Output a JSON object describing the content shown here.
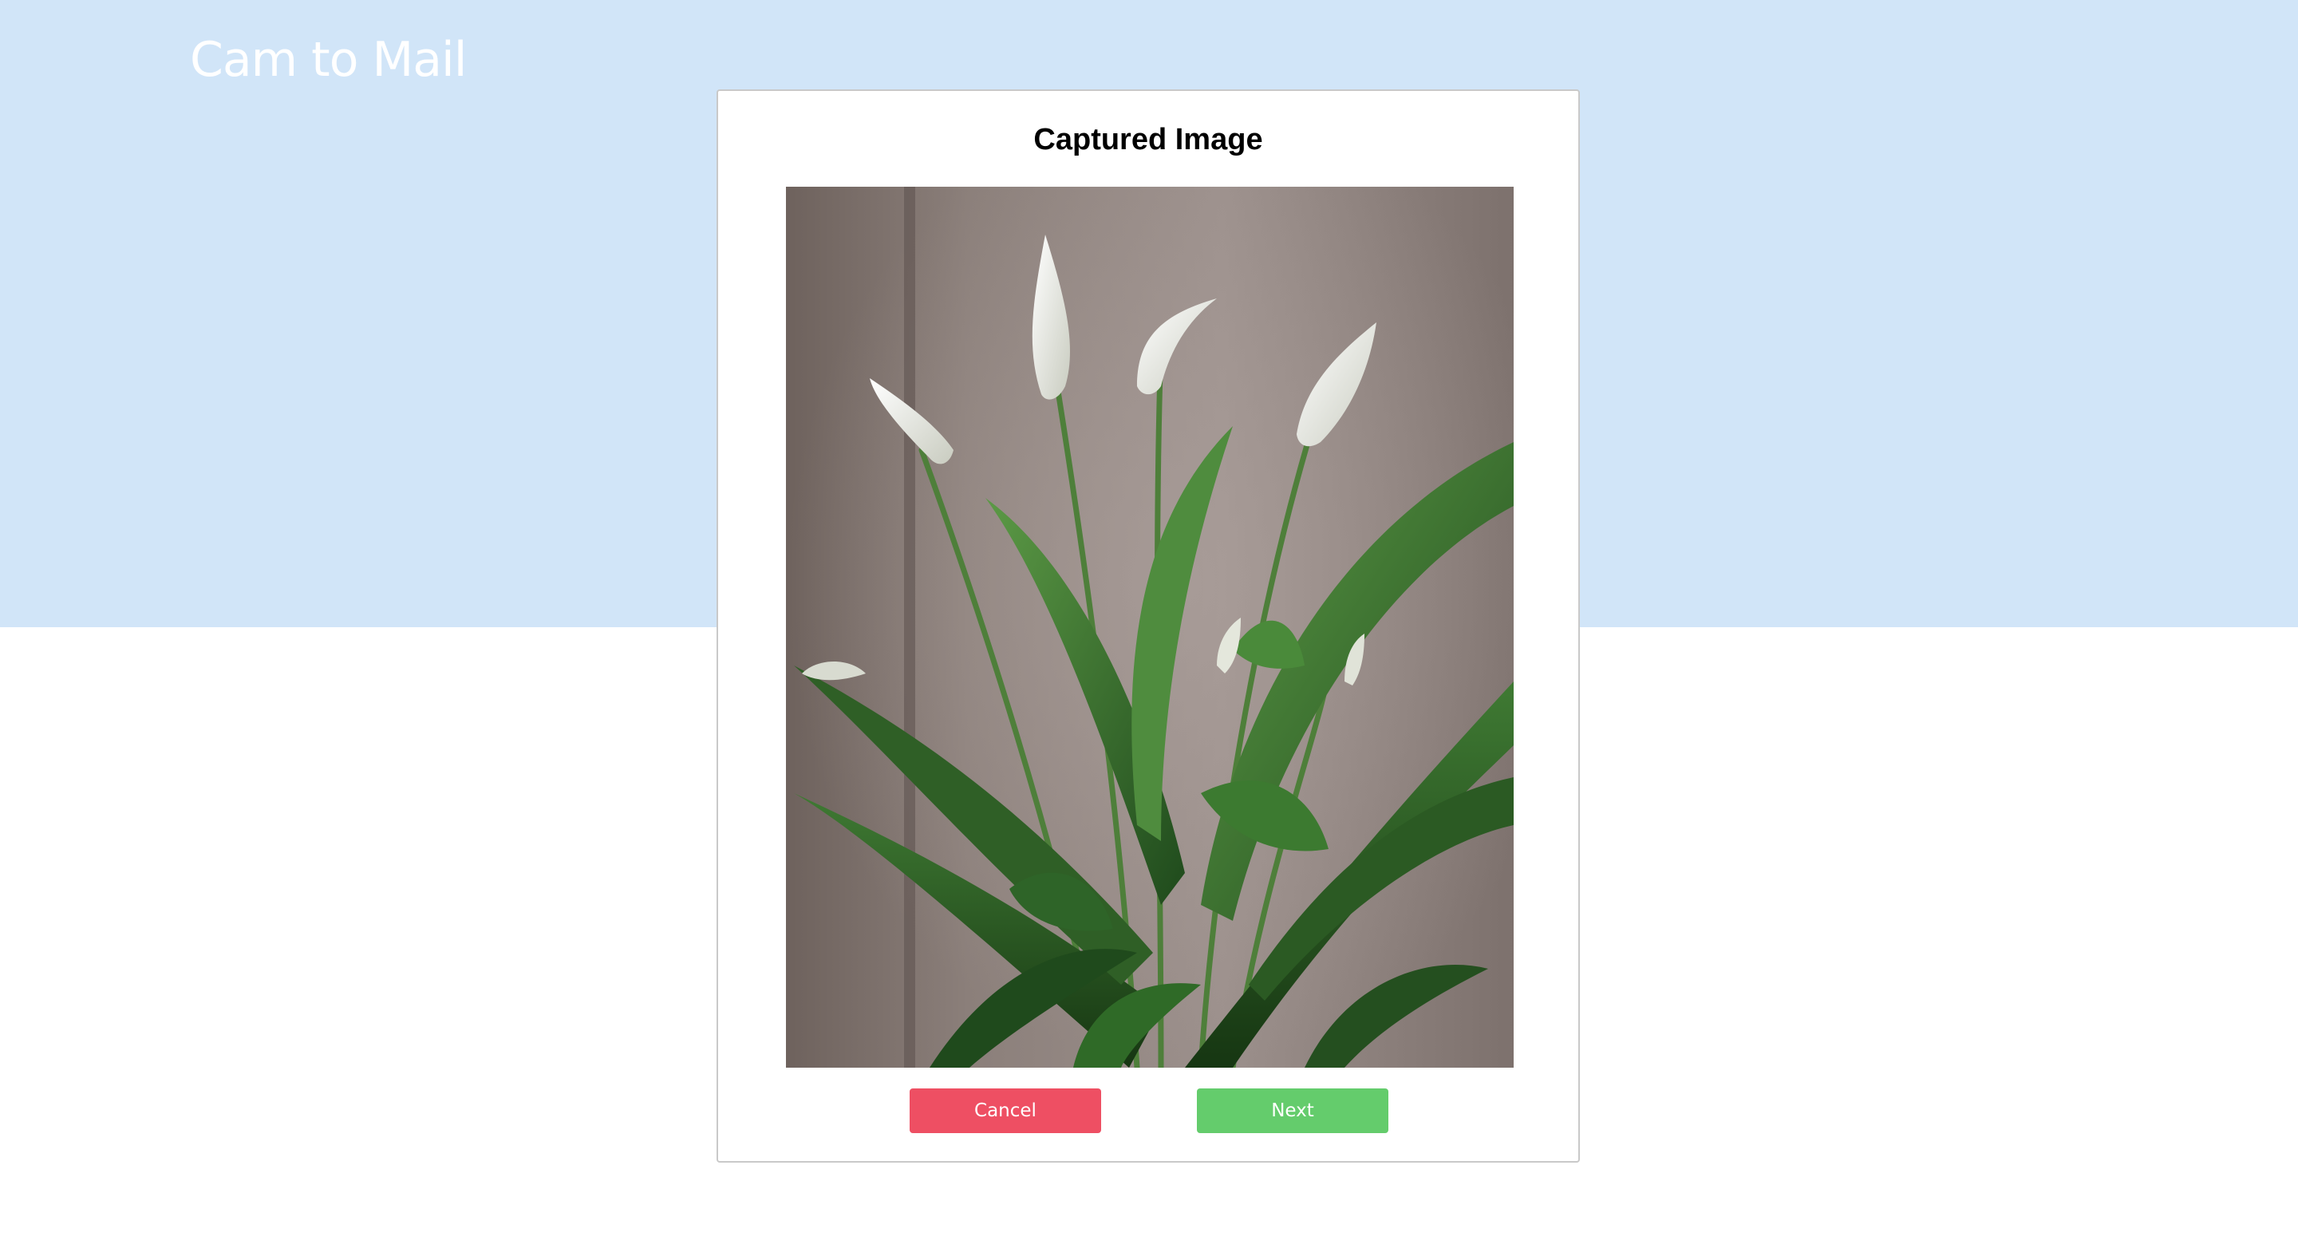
{
  "app": {
    "brand": "Cam to Mail"
  },
  "dialog": {
    "title": "Captured Image",
    "image_subject": "peace lily plant photo",
    "cancel_label": "Cancel",
    "next_label": "Next"
  },
  "colors": {
    "hero_background": "#d1e5f8",
    "cancel_button": "#ee4f63",
    "next_button": "#64cc6c",
    "modal_border": "#c9c9c9"
  }
}
